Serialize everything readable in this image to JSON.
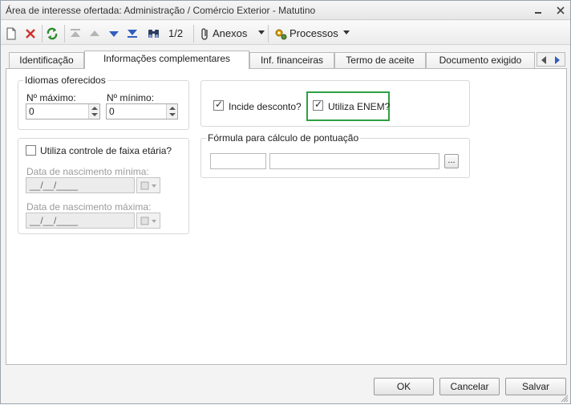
{
  "window": {
    "title": "Área de interesse ofertada: Administração / Comércio Exterior - Matutino"
  },
  "toolbar": {
    "record_position": "1/2",
    "attachments_label": "Anexos",
    "processes_label": "Processos"
  },
  "tabs": [
    {
      "label": "Identificação",
      "active": false
    },
    {
      "label": "Informações complementares",
      "active": true
    },
    {
      "label": "Inf. financeiras",
      "active": false
    },
    {
      "label": "Termo de aceite",
      "active": false
    },
    {
      "label": "Documento exigido",
      "active": false
    }
  ],
  "idiomas": {
    "legend": "Idiomas oferecidos",
    "max_label": "Nº máximo:",
    "max_value": "0",
    "min_label": "Nº mínimo:",
    "min_value": "0"
  },
  "faixa_etaria": {
    "checkbox_label": "Utiliza controle de faixa etária?",
    "checked": false,
    "min_date_label": "Data de nascimento mínima:",
    "min_date_value": "__/__/____",
    "max_date_label": "Data de nascimento máxima:",
    "max_date_value": "__/__/____"
  },
  "options": {
    "incide_desconto_label": "Incide desconto?",
    "incide_desconto_checked": true,
    "utiliza_enem_label": "Utiliza ENEM?",
    "utiliza_enem_checked": true,
    "highlight_color": "#2ea043"
  },
  "formula": {
    "legend": "Fórmula para cálculo de pontuação",
    "code_value": "",
    "description_value": "",
    "lookup_button": "..."
  },
  "footer": {
    "ok_label": "OK",
    "cancel_label": "Cancelar",
    "save_label": "Salvar"
  }
}
